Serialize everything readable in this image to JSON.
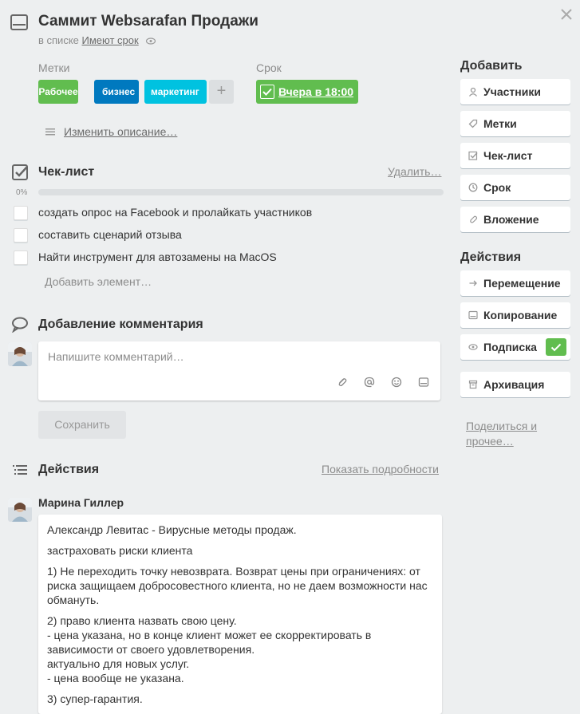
{
  "header": {
    "title": "Саммит Websarafan Продажи",
    "list_prefix": "в списке",
    "list_name": "Имеют срок"
  },
  "labels": {
    "heading": "Метки",
    "items": [
      {
        "text": "Рабочее",
        "color": "#61bd4f"
      },
      {
        "text": "бизнес",
        "color": "#0079bf"
      },
      {
        "text": "маркетинг",
        "color": "#00c2e0"
      }
    ],
    "add": "+"
  },
  "due": {
    "heading": "Срок",
    "value": "Вчера в 18:00",
    "color": "#61bd4f"
  },
  "description": {
    "edit_link": "Изменить описание…"
  },
  "checklist": {
    "title": "Чек-лист",
    "delete": "Удалить…",
    "progress": "0%",
    "progress_value": 0,
    "items": [
      "создать опрос на Facebook и пролайкать участников",
      "составить сценарий отзыва",
      "Найти инструмент для автозамены на MacOS"
    ],
    "add_item": "Добавить элемент…"
  },
  "comment": {
    "title": "Добавление комментария",
    "placeholder": "Напишите комментарий…",
    "save": "Сохранить",
    "tools": [
      "paperclip-icon",
      "at-icon",
      "emoji-icon",
      "card-icon"
    ]
  },
  "activity": {
    "title": "Действия",
    "details_link": "Показать подробности",
    "author": "Марина Гиллер",
    "paragraphs": [
      "Александр Левитас - Вирусные методы продаж.",
      "застраховать риски клиента",
      "1) Не переходить точку невозврата. Возврат цены при ограничениях: от риска защищаем добросовестного клиента, но не даем возможности нас обмануть.",
      "2) право клиента назвать свою цену.\n- цена указана, но в конце клиент может ее скорректировать в зависимости от своего удовлетворения.\nактуально для новых услуг.\n- цена вообще не указана.",
      "3) супер-гарантия."
    ]
  },
  "sidebar": {
    "add_heading": "Добавить",
    "add_buttons": [
      {
        "label": "Участники",
        "icon": "person-icon"
      },
      {
        "label": "Метки",
        "icon": "tag-icon"
      },
      {
        "label": "Чек-лист",
        "icon": "checklist-icon"
      },
      {
        "label": "Срок",
        "icon": "clock-icon"
      },
      {
        "label": "Вложение",
        "icon": "paperclip-icon"
      }
    ],
    "actions_heading": "Действия",
    "action_buttons": [
      {
        "label": "Перемещение",
        "icon": "arrow-right-icon"
      },
      {
        "label": "Копирование",
        "icon": "card-icon"
      },
      {
        "label": "Подписка",
        "icon": "eye-icon"
      },
      {
        "label": "Архивация",
        "icon": "archive-icon"
      }
    ],
    "share_link": "Поделиться и прочее…"
  }
}
